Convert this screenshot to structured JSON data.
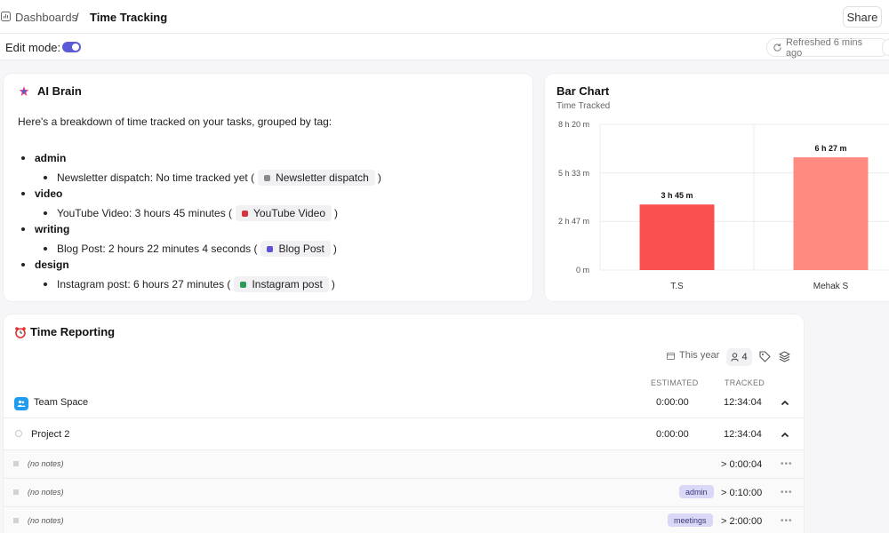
{
  "breadcrumb": {
    "parent": "Dashboards",
    "separator": "/",
    "current": "Time Tracking"
  },
  "header": {
    "share_label": "Share"
  },
  "edit_bar": {
    "edit_label": "Edit mode:",
    "edit_on": true,
    "refresh_label": "Refreshed 6 mins ago"
  },
  "ai_brain": {
    "title": "AI Brain",
    "intro": "Here's a breakdown of time tracked on your tasks, grouped by tag:",
    "groups": [
      {
        "tag": "admin",
        "task_text": "Newsletter dispatch: No time tracked yet (",
        "chip": "Newsletter dispatch",
        "chip_color": "#8a8a8a",
        "close": ")"
      },
      {
        "tag": "video",
        "task_text": "YouTube Video: 3 hours 45 minutes (",
        "chip": "YouTube Video",
        "chip_color": "#d6333f",
        "close": ")"
      },
      {
        "tag": "writing",
        "task_text": "Blog Post: 2 hours 22 minutes 4 seconds (",
        "chip": "Blog Post",
        "chip_color": "#5b52d6",
        "close": ")"
      },
      {
        "tag": "design",
        "task_text": "Instagram post: 6 hours 27 minutes (",
        "chip": "Instagram post",
        "chip_color": "#2e9a5a",
        "close": ")"
      }
    ]
  },
  "chart_data": {
    "type": "bar",
    "title": "Bar Chart",
    "subtitle": "Time Tracked",
    "categories": [
      "T.S",
      "Mehak S"
    ],
    "values_minutes": [
      225,
      387
    ],
    "value_labels": [
      "3 h 45 m",
      "6 h 27 m"
    ],
    "bar_colors": [
      "#fb5050",
      "#ff8a80"
    ],
    "ylim_minutes": [
      0,
      500
    ],
    "y_ticks_minutes": [
      0,
      167,
      333,
      500
    ],
    "y_tick_labels": [
      "0 m",
      "2 h 47 m",
      "5 h 33 m",
      "8 h 20 m"
    ],
    "grid": true
  },
  "report": {
    "title": "Time Reporting",
    "period": "This year",
    "people_count": "4",
    "col_estimated": "ESTIMATED",
    "col_tracked": "TRACKED",
    "space_row": {
      "name": "Team Space",
      "estimated": "0:00:00",
      "tracked": "12:34:04"
    },
    "project_row": {
      "name": "Project 2",
      "estimated": "0:00:00",
      "tracked": "12:34:04"
    },
    "entries": [
      {
        "notes": "(no notes)",
        "tag": "",
        "tracked": "> 0:00:04"
      },
      {
        "notes": "(no notes)",
        "tag": "admin",
        "tracked": "> 0:10:00"
      },
      {
        "notes": "(no notes)",
        "tag": "meetings",
        "tracked": "> 2:00:00"
      }
    ]
  }
}
